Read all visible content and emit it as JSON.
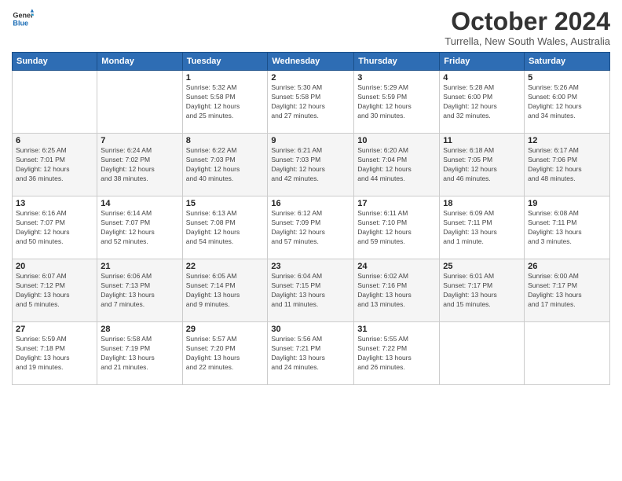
{
  "logo": {
    "line1": "General",
    "line2": "Blue"
  },
  "title": "October 2024",
  "subtitle": "Turrella, New South Wales, Australia",
  "days_header": [
    "Sunday",
    "Monday",
    "Tuesday",
    "Wednesday",
    "Thursday",
    "Friday",
    "Saturday"
  ],
  "weeks": [
    [
      {
        "day": "",
        "info": ""
      },
      {
        "day": "",
        "info": ""
      },
      {
        "day": "1",
        "info": "Sunrise: 5:32 AM\nSunset: 5:58 PM\nDaylight: 12 hours\nand 25 minutes."
      },
      {
        "day": "2",
        "info": "Sunrise: 5:30 AM\nSunset: 5:58 PM\nDaylight: 12 hours\nand 27 minutes."
      },
      {
        "day": "3",
        "info": "Sunrise: 5:29 AM\nSunset: 5:59 PM\nDaylight: 12 hours\nand 30 minutes."
      },
      {
        "day": "4",
        "info": "Sunrise: 5:28 AM\nSunset: 6:00 PM\nDaylight: 12 hours\nand 32 minutes."
      },
      {
        "day": "5",
        "info": "Sunrise: 5:26 AM\nSunset: 6:00 PM\nDaylight: 12 hours\nand 34 minutes."
      }
    ],
    [
      {
        "day": "6",
        "info": "Sunrise: 6:25 AM\nSunset: 7:01 PM\nDaylight: 12 hours\nand 36 minutes."
      },
      {
        "day": "7",
        "info": "Sunrise: 6:24 AM\nSunset: 7:02 PM\nDaylight: 12 hours\nand 38 minutes."
      },
      {
        "day": "8",
        "info": "Sunrise: 6:22 AM\nSunset: 7:03 PM\nDaylight: 12 hours\nand 40 minutes."
      },
      {
        "day": "9",
        "info": "Sunrise: 6:21 AM\nSunset: 7:03 PM\nDaylight: 12 hours\nand 42 minutes."
      },
      {
        "day": "10",
        "info": "Sunrise: 6:20 AM\nSunset: 7:04 PM\nDaylight: 12 hours\nand 44 minutes."
      },
      {
        "day": "11",
        "info": "Sunrise: 6:18 AM\nSunset: 7:05 PM\nDaylight: 12 hours\nand 46 minutes."
      },
      {
        "day": "12",
        "info": "Sunrise: 6:17 AM\nSunset: 7:06 PM\nDaylight: 12 hours\nand 48 minutes."
      }
    ],
    [
      {
        "day": "13",
        "info": "Sunrise: 6:16 AM\nSunset: 7:07 PM\nDaylight: 12 hours\nand 50 minutes."
      },
      {
        "day": "14",
        "info": "Sunrise: 6:14 AM\nSunset: 7:07 PM\nDaylight: 12 hours\nand 52 minutes."
      },
      {
        "day": "15",
        "info": "Sunrise: 6:13 AM\nSunset: 7:08 PM\nDaylight: 12 hours\nand 54 minutes."
      },
      {
        "day": "16",
        "info": "Sunrise: 6:12 AM\nSunset: 7:09 PM\nDaylight: 12 hours\nand 57 minutes."
      },
      {
        "day": "17",
        "info": "Sunrise: 6:11 AM\nSunset: 7:10 PM\nDaylight: 12 hours\nand 59 minutes."
      },
      {
        "day": "18",
        "info": "Sunrise: 6:09 AM\nSunset: 7:11 PM\nDaylight: 13 hours\nand 1 minute."
      },
      {
        "day": "19",
        "info": "Sunrise: 6:08 AM\nSunset: 7:11 PM\nDaylight: 13 hours\nand 3 minutes."
      }
    ],
    [
      {
        "day": "20",
        "info": "Sunrise: 6:07 AM\nSunset: 7:12 PM\nDaylight: 13 hours\nand 5 minutes."
      },
      {
        "day": "21",
        "info": "Sunrise: 6:06 AM\nSunset: 7:13 PM\nDaylight: 13 hours\nand 7 minutes."
      },
      {
        "day": "22",
        "info": "Sunrise: 6:05 AM\nSunset: 7:14 PM\nDaylight: 13 hours\nand 9 minutes."
      },
      {
        "day": "23",
        "info": "Sunrise: 6:04 AM\nSunset: 7:15 PM\nDaylight: 13 hours\nand 11 minutes."
      },
      {
        "day": "24",
        "info": "Sunrise: 6:02 AM\nSunset: 7:16 PM\nDaylight: 13 hours\nand 13 minutes."
      },
      {
        "day": "25",
        "info": "Sunrise: 6:01 AM\nSunset: 7:17 PM\nDaylight: 13 hours\nand 15 minutes."
      },
      {
        "day": "26",
        "info": "Sunrise: 6:00 AM\nSunset: 7:17 PM\nDaylight: 13 hours\nand 17 minutes."
      }
    ],
    [
      {
        "day": "27",
        "info": "Sunrise: 5:59 AM\nSunset: 7:18 PM\nDaylight: 13 hours\nand 19 minutes."
      },
      {
        "day": "28",
        "info": "Sunrise: 5:58 AM\nSunset: 7:19 PM\nDaylight: 13 hours\nand 21 minutes."
      },
      {
        "day": "29",
        "info": "Sunrise: 5:57 AM\nSunset: 7:20 PM\nDaylight: 13 hours\nand 22 minutes."
      },
      {
        "day": "30",
        "info": "Sunrise: 5:56 AM\nSunset: 7:21 PM\nDaylight: 13 hours\nand 24 minutes."
      },
      {
        "day": "31",
        "info": "Sunrise: 5:55 AM\nSunset: 7:22 PM\nDaylight: 13 hours\nand 26 minutes."
      },
      {
        "day": "",
        "info": ""
      },
      {
        "day": "",
        "info": ""
      }
    ]
  ]
}
